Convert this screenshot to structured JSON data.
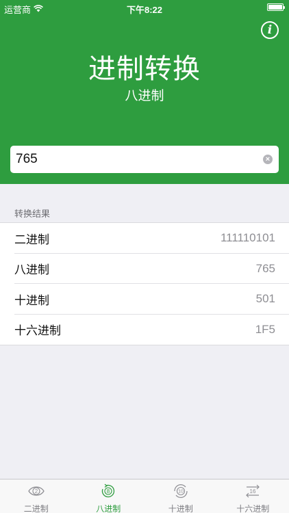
{
  "status_bar": {
    "carrier": "运营商",
    "time": "下午8:22"
  },
  "header": {
    "title": "进制转换",
    "subtitle": "八进制"
  },
  "input": {
    "value": "765"
  },
  "results": {
    "section_label": "转换结果",
    "rows": [
      {
        "label": "二进制",
        "value": "111110101"
      },
      {
        "label": "八进制",
        "value": "765"
      },
      {
        "label": "十进制",
        "value": "501"
      },
      {
        "label": "十六进制",
        "value": "1F5"
      }
    ]
  },
  "tabs": [
    {
      "label": "二进制",
      "icon": "binary-tab-icon",
      "badge": "2",
      "active": false
    },
    {
      "label": "八进制",
      "icon": "octal-tab-icon",
      "badge": "8",
      "active": true
    },
    {
      "label": "十进制",
      "icon": "decimal-tab-icon",
      "badge": "10",
      "active": false
    },
    {
      "label": "十六进制",
      "icon": "hexadecimal-tab-icon",
      "badge": "16",
      "active": false
    }
  ],
  "colors": {
    "accent": "#2e9d3f",
    "background": "#efeff4",
    "inactive_tab": "#7d7d82"
  },
  "icons": {
    "wifi": "wifi-icon",
    "battery": "battery-icon",
    "info": "info-icon",
    "clear": "clear-icon"
  }
}
